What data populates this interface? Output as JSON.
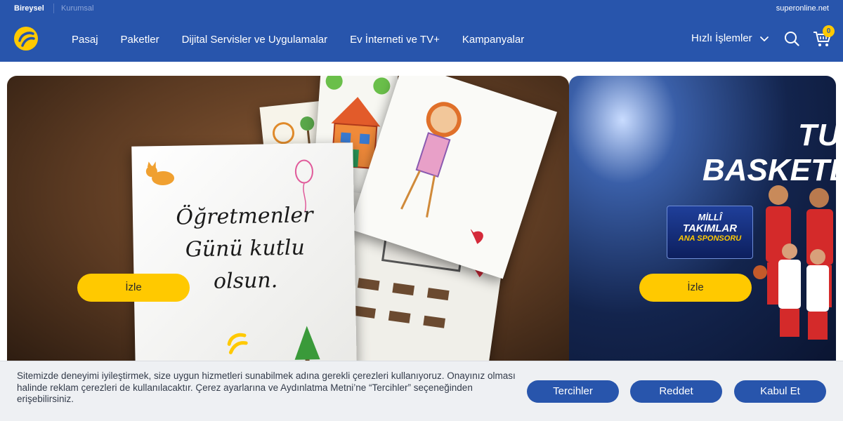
{
  "topbar": {
    "segments": [
      "Bireysel",
      "Kurumsal"
    ],
    "right_link": "superonline.net"
  },
  "header": {
    "nav": [
      "Pasaj",
      "Paketler",
      "Dijital Servisler ve Uygulamalar",
      "Ev İnterneti ve TV+",
      "Kampanyalar"
    ],
    "quick_actions": "Hızlı İşlemler",
    "cart_count": "0"
  },
  "banners": [
    {
      "card_text_line1": "Öğretmenler",
      "card_text_line2": "Günü kutlu olsun.",
      "button": "İzle"
    },
    {
      "title_line1": "TUR",
      "title_line2": "BASKETBOL",
      "sponsor_l1": "MİLLÎ",
      "sponsor_l2": "TAKIMLAR",
      "sponsor_l3": "ANA SPONSORU",
      "button": "İzle"
    }
  ],
  "cookie": {
    "text": "Sitemizde deneyimi iyileştirmek, size uygun hizmetleri sunabilmek adına gerekli çerezleri kullanıyoruz. Onayınız olması halinde reklam çerezleri de kullanılacaktır. Çerez ayarlarına ve Aydınlatma Metni’ne “Tercihler” seçeneğinden erişebilirsiniz.",
    "buttons": [
      "Tercihler",
      "Reddet",
      "Kabul Et"
    ]
  },
  "colors": {
    "brand_blue": "#2855ac",
    "accent_yellow": "#ffc900"
  },
  "icons": [
    "turkcell-logo",
    "chevron-down-icon",
    "search-icon",
    "cart-icon"
  ]
}
